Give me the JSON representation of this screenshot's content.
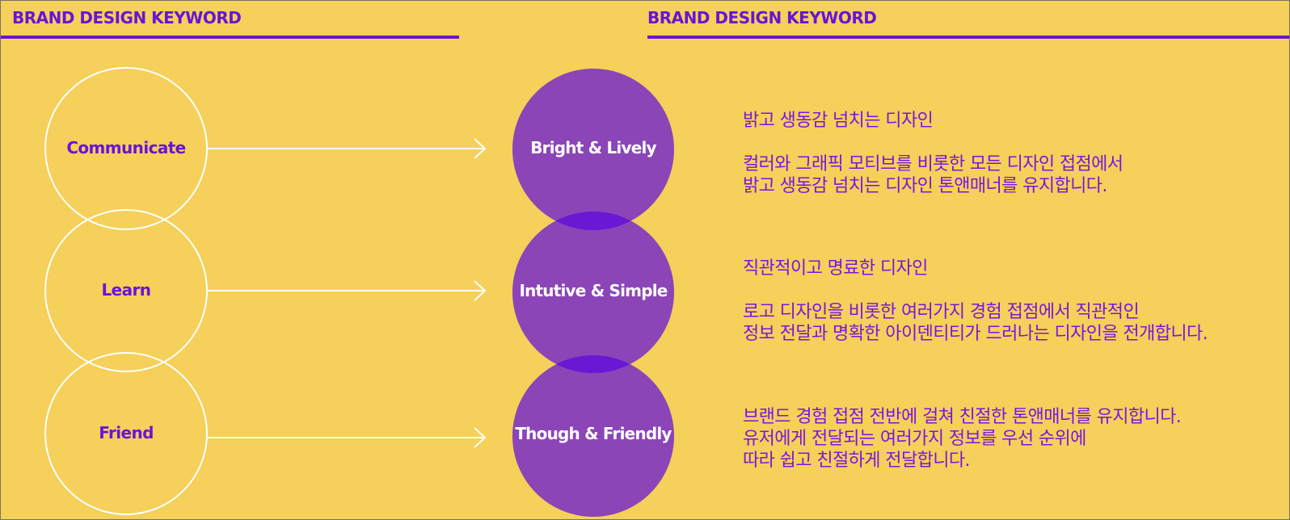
{
  "headers": {
    "left_title": "BRAND DESIGN KEYWORD",
    "right_title": "BRAND DESIGN KEYWORD"
  },
  "colors": {
    "background": "#f5d05a",
    "accent": "#6a14d6",
    "circle_fill": "#8b45b7",
    "circle_overlap": "#6a18d4",
    "outline": "#ffffff"
  },
  "rows": [
    {
      "keyword": "Communicate",
      "value": "Bright & Lively",
      "heading": "밝고 생동감 넘치는 디자인",
      "lines": [
        "컬러와 그래픽 모티브를 비롯한 모든 디자인 접점에서",
        "밝고 생동감 넘치는 디자인 톤앤매너를 유지합니다."
      ]
    },
    {
      "keyword": "Learn",
      "value": "Intutive & Simple",
      "heading": "직관적이고 명료한 디자인",
      "lines": [
        "로고 디자인을 비롯한 여러가지 경험 접점에서 직관적인",
        "정보 전달과 명확한 아이덴티티가 드러나는 디자인을 전개합니다."
      ]
    },
    {
      "keyword": "Friend",
      "value": "Though & Friendly",
      "heading": "",
      "lines": [
        "브랜드 경험 접점 전반에 걸쳐 친절한 톤앤매너를 유지합니다.",
        "유저에게 전달되는 여러가지 정보를 우선 순위에",
        "따라 쉽고 친절하게 전달합니다."
      ]
    }
  ]
}
